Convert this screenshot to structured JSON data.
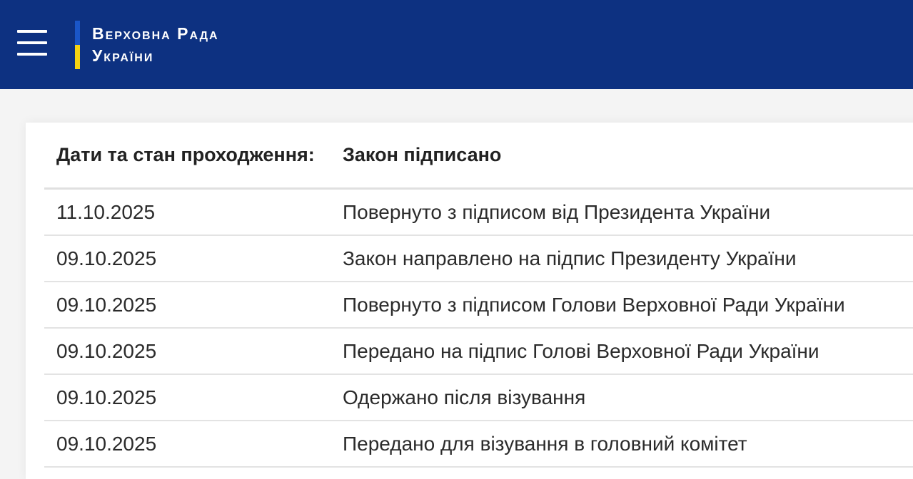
{
  "header": {
    "logo_line1": "Верховна Рада",
    "logo_line2": "України",
    "colors": {
      "background": "#0d3181",
      "flag_blue": "#1a56c8",
      "flag_yellow": "#f5d312"
    }
  },
  "table": {
    "header_label": "Дати та стан проходження:",
    "header_value": "Закон підписано",
    "rows": [
      {
        "date": "11.10.2025",
        "status": "Повернуто з підписом від Президента України"
      },
      {
        "date": "09.10.2025",
        "status": "Закон направлено на підпис Президенту України"
      },
      {
        "date": "09.10.2025",
        "status": "Повернуто з підписом Голови Верховної Ради України"
      },
      {
        "date": "09.10.2025",
        "status": "Передано на підпис Голові Верховної Ради України"
      },
      {
        "date": "09.10.2025",
        "status": "Одержано після візування"
      },
      {
        "date": "09.10.2025",
        "status": "Передано для візування в головний комітет"
      }
    ]
  }
}
